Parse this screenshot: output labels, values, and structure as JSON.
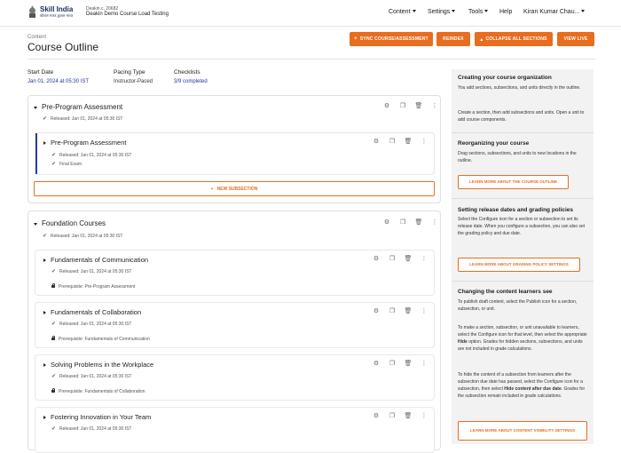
{
  "header": {
    "logo_text": "Skill India",
    "logo_sub": "कौशल भारत-कुशल भारत",
    "org": "Deakin.c, 20682",
    "course_name": "Deakin Demo Course Load Testing",
    "nav": {
      "content": "Content",
      "settings": "Settings",
      "tools": "Tools",
      "help": "Help",
      "user": "Kiran Kumar Chau..."
    }
  },
  "page": {
    "breadcrumb": "Content",
    "title": "Course Outline",
    "buttons": {
      "sync": "SYNC COURSE/ASSESSMENT",
      "reindex": "REINDEX",
      "collapse": "COLLAPSE ALL SECTIONS",
      "view_live": "VIEW LIVE"
    }
  },
  "stats": {
    "start_date_label": "Start Date",
    "start_date_value": "Jan 01, 2024 at 05:30 IST",
    "pacing_label": "Pacing Type",
    "pacing_value": "Instructor-Paced",
    "checklists_label": "Checklists",
    "checklists_value": "3/9 completed"
  },
  "sections": [
    {
      "title": "Pre-Program Assessment",
      "released": "Released: Jan 01, 2024 at 05:30 IST",
      "subsections": [
        {
          "title": "Pre-Program Assessment",
          "released": "Released: Jan 01, 2024 at 05:30 IST",
          "extra": "Final Exam"
        }
      ],
      "new_subsection": "NEW SUBSECTION"
    },
    {
      "title": "Foundation Courses",
      "released": "Released: Jan 01, 2024 at 05:30 IST",
      "subsections": [
        {
          "title": "Fundamentals of Communication",
          "released": "Released: Jan 01, 2024 at 05:30 IST",
          "prereq": "Prerequisite: Pre-Program Assessment"
        },
        {
          "title": "Fundamentals of Collaboration",
          "released": "Released: Jan 01, 2024 at 05:30 IST",
          "prereq": "Prerequisite: Fundamentals of Communication"
        },
        {
          "title": "Solving Problems in the Workplace",
          "released": "Released: Jan 01, 2024 at 05:30 IST",
          "prereq": "Prerequisite: Fundamentals of Collaboration"
        },
        {
          "title": "Fostering Innovation in Your Team",
          "released": "Released: Jan 01, 2024 at 05:30 IST"
        }
      ]
    }
  ],
  "sidebar": {
    "h1": "Creating your course organization",
    "p1": "You add sections, subsections, and units directly in the outline.",
    "p2": "Create a section, then add subsections and units. Open a unit to add course components.",
    "h2": "Reorganizing your course",
    "p3": "Drag sections, subsections, and units to new locations in the outline.",
    "btn1": "LEARN MORE ABOUT THE COURSE OUTLINE",
    "h3": "Setting release dates and grading policies",
    "p4": "Select the Configure icon for a section or subsection to set its release date. When you configure a subsection, you can also set the grading policy and due date.",
    "btn2": "LEARN MORE ABOUT GRADING POLICY SETTINGS",
    "h4": "Changing the content learners see",
    "p5": "To publish draft content, select the Publish icon for a section, subsection, or unit.",
    "p6a": "To make a section, subsection, or unit unavailable to learners, select the Configure icon for that level, then select the appropriate ",
    "p6b": "Hide",
    "p6c": " option. Grades for hidden sections, subsections, and units are not included in grade calculations.",
    "p7a": "To hide the content of a subsection from learners after the subsection due date has passed, select the Configure icon for a subsection, then select ",
    "p7b": "Hide content after due date",
    "p7c": ". Grades for the subsection remain included in grade calculations.",
    "btn3": "LEARN MORE ABOUT CONTENT VISIBILITY SETTINGS"
  },
  "colors": {
    "accent": "#e86d1f",
    "link": "#1f3a93",
    "bar": "#2a3fa0"
  }
}
